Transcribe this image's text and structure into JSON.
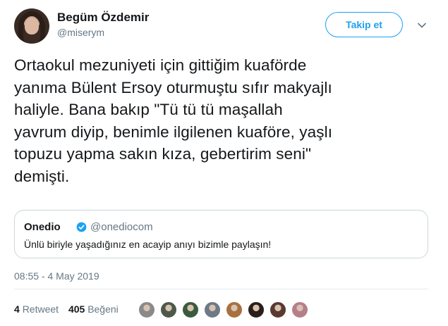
{
  "tweet": {
    "author_name": "Begüm Özdemir",
    "author_handle": "@miserym",
    "follow_label": "Takip et",
    "text": "Ortaokul mezuniyeti için gittiğim kuaförde\nyanıma Bülent Ersoy oturmuştu sıfır makyajlı\nhaliyle. Bana bakıp \"Tü tü tü maşallah\nyavrum diyip, benimle ilgilenen kuaföre, yaşlı\ntopuzu yapma sakın kıza, gebertirim seni\"\ndemişti.",
    "timestamp": "08:55 - 4 May 2019"
  },
  "quote": {
    "name": "Onedio",
    "handle": "@onediocom",
    "text": "Ünlü biriyle yaşadığınız en acayip anıyı bizimle paylaşın!"
  },
  "stats": {
    "retweet_count": "4",
    "retweet_label": "Retweet",
    "like_count": "405",
    "like_label": "Beğeni"
  },
  "likers": {
    "colors": [
      "#8a8a8a",
      "#4d5a4a",
      "#3b5b3e",
      "#6d7a86",
      "#a8703f",
      "#2a1f1a",
      "#5a3a30",
      "#b57f8a"
    ]
  },
  "colors": {
    "accent": "#1da1f2",
    "text": "#14171a",
    "secondary": "#657786",
    "border": "#ccd6dd"
  }
}
